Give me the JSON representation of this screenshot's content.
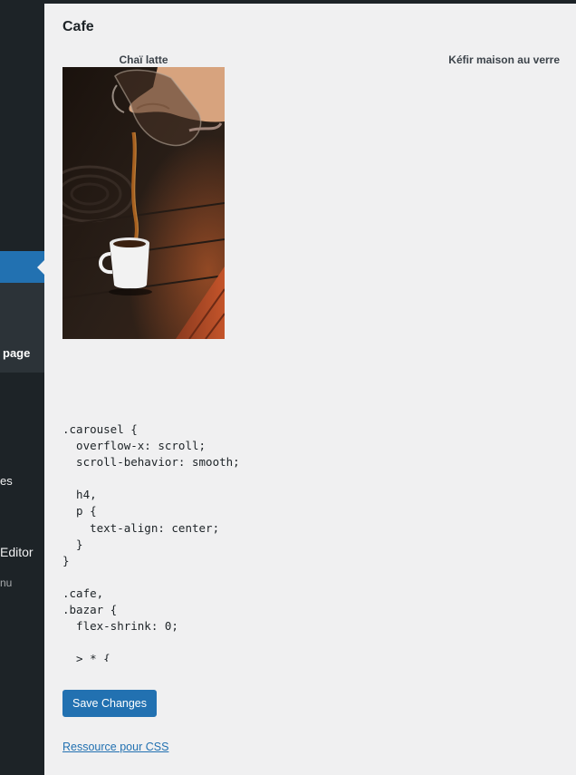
{
  "sidebar": {
    "active_item_partial": "page",
    "item_es_partial": "es",
    "item_editor_partial": "Editor",
    "item_nu_partial": "nu"
  },
  "page": {
    "title": "Cafe"
  },
  "cards": [
    {
      "label": "Chaï latte"
    },
    {
      "label": "Kéfir maison au verre"
    }
  ],
  "photo": {
    "icon": "coffee-pour-photo"
  },
  "css_code": ".carousel {\n  overflow-x: scroll;\n  scroll-behavior: smooth;\n\n  h4,\n  p {\n    text-align: center;\n  }\n}\n\n.cafe,\n.bazar {\n  flex-shrink: 0;\n\n  > * {",
  "actions": {
    "save_label": "Save Changes",
    "resource_link": "Ressource pour CSS"
  },
  "colors": {
    "accent": "#2271b1",
    "sidebar": "#1d2327",
    "background": "#f0f0f1"
  }
}
